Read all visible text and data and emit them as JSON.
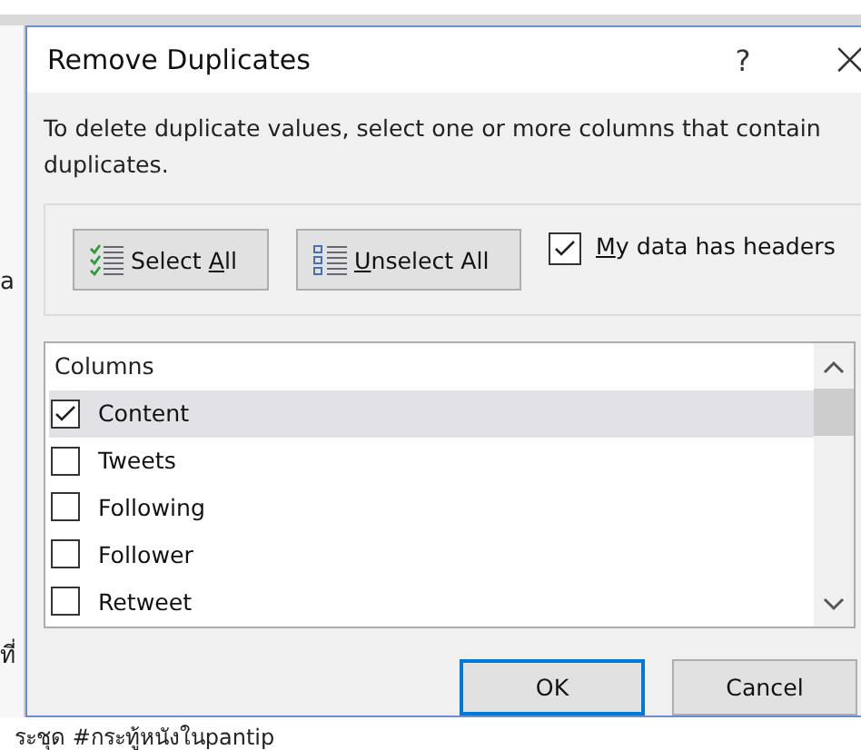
{
  "background": {
    "left_fragments": [
      "a",
      "ที่"
    ],
    "bottom_text": "ระชุด #กระทู้หนังในpantip"
  },
  "window": {
    "title": "Remove Duplicates",
    "help": "?",
    "close": "×"
  },
  "instructions": "To delete duplicate values, select one or more columns that contain duplicates.",
  "buttons_row": [
    {
      "label_before": "Select ",
      "access_key": "A",
      "label_after": "ll",
      "kind": "select"
    },
    {
      "access_key": "U",
      "label_after": "nselect All",
      "kind": "unselect"
    }
  ],
  "headers_checkbox": {
    "access_key": "M",
    "label_after": "y data has headers",
    "checked": true
  },
  "columns_list": {
    "header": "Columns",
    "items": [
      {
        "name": "Content",
        "checked": true,
        "selected": true
      },
      {
        "name": "Tweets",
        "checked": false,
        "selected": false
      },
      {
        "name": "Following",
        "checked": false,
        "selected": false
      },
      {
        "name": "Follower",
        "checked": false,
        "selected": false
      },
      {
        "name": "Retweet",
        "checked": false,
        "selected": false
      }
    ]
  },
  "footer_buttons": [
    {
      "label": "OK",
      "default": true
    },
    {
      "label": "Cancel",
      "default": false
    }
  ]
}
